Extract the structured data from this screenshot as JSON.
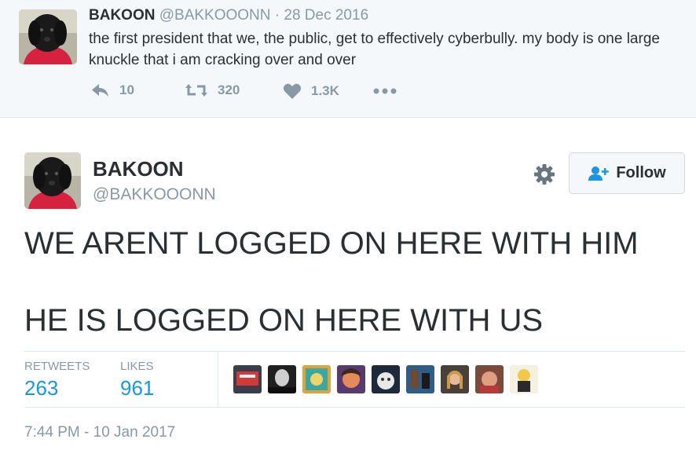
{
  "parent_tweet": {
    "name": "BAKOON",
    "handle": "@BAKKOOONN",
    "separator": "·",
    "date": "28 Dec 2016",
    "text": "the first president that we, the public,  get to effectively cyberbully. my body is one large knuckle that i am cracking over and over",
    "actions": {
      "reply_count": "10",
      "retweet_count": "320",
      "like_count": "1.3K"
    },
    "icons": [
      "reply-icon",
      "retweet-icon",
      "heart-icon",
      "more-icon"
    ]
  },
  "main_tweet": {
    "name": "BAKOON",
    "handle": "@BAKKOOONN",
    "follow_label": "Follow",
    "lines": [
      "WE ARENT LOGGED ON HERE WITH HIM",
      "HE IS LOGGED ON HERE WITH US"
    ],
    "stats": {
      "retweets_label": "RETWEETS",
      "retweets_value": "263",
      "likes_label": "LIKES",
      "likes_value": "961"
    },
    "timestamp": "7:44 PM - 10 Jan 2017",
    "icons": [
      "gear-icon",
      "follow-person-icon"
    ]
  },
  "colors": {
    "link_blue": "#1b95e0",
    "muted_gray": "#8899a6",
    "text_dark": "#292f33",
    "parent_bg": "#f5f8fa"
  }
}
